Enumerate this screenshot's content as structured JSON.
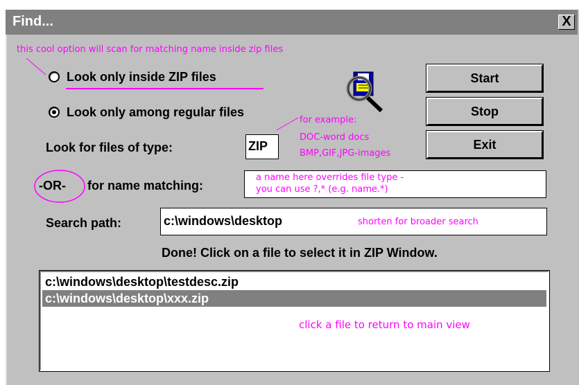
{
  "window": {
    "title": "Find...",
    "close_label": "X"
  },
  "annotations": {
    "zip_note": "this cool option will scan for matching name inside zip files",
    "example_1": "for example:",
    "example_2": "DOC-word docs",
    "example_3": "BMP,GIF,JPG-images",
    "override_1": "a name here overrides file type -",
    "override_2": "you can use ?,*   (e.g. name.*)",
    "shorten": "shorten for broader search",
    "click_file": "click a file to return to main view"
  },
  "options": {
    "zip_label": "Look only inside ZIP files",
    "regular_label": "Look only among regular files",
    "selected": "regular"
  },
  "buttons": {
    "start": "Start",
    "stop": "Stop",
    "exit": "Exit"
  },
  "fields": {
    "type_label": "Look for files of type:",
    "type_value": "ZIP",
    "or_label": "-OR-",
    "name_label": "for name matching:",
    "name_value": "",
    "path_label": "Search path:",
    "path_value": "c:\\windows\\desktop"
  },
  "status": "Done!  Click on a file to select it in ZIP Window.",
  "results": [
    {
      "path": "c:\\windows\\desktop\\testdesc.zip",
      "selected": false
    },
    {
      "path": "c:\\windows\\desktop\\xxx.zip",
      "selected": true
    }
  ],
  "colors": {
    "annotation": "#ff00ff",
    "face": "#c0c0c0",
    "titlebar": "#808080",
    "selection": "#808080"
  },
  "icons": [
    "floppy-magnifier-icon",
    "close-icon"
  ]
}
